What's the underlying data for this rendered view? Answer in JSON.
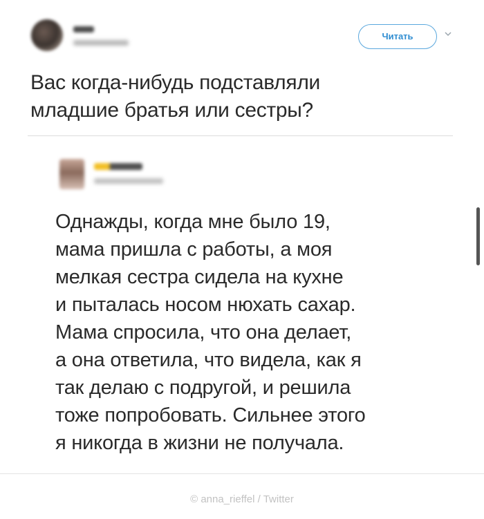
{
  "header": {
    "follow_label": "Читать",
    "chevron_icon": "chevron-down-icon"
  },
  "tweet": {
    "lines": [
      "Вас когда-нибудь подставляли",
      "младшие братья или сестры?"
    ]
  },
  "reply": {
    "lines": [
      "Однажды, когда мне было 19,",
      "мама пришла с работы, а моя",
      "мелкая сестра сидела на кухне",
      "и пыталась носом нюхать сахар.",
      "Мама спросила, что она делает,",
      "а она ответила, что видела, как я",
      "так делаю с подругой, и решила",
      "тоже попробовать. Сильнее этого",
      "я никогда в жизни не получала."
    ]
  },
  "credit": "© anna_rieffel / Twitter",
  "colors": {
    "accent": "#2f8dd1",
    "text": "#2a2a2a",
    "credit": "#c2c2c2"
  }
}
